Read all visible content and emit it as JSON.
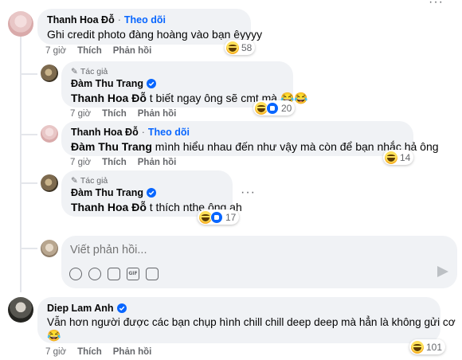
{
  "top_more": "···",
  "comment1": {
    "name": "Thanh Hoa Đỗ",
    "follow": "Theo dõi",
    "text": "Ghi credit photo đàng hoàng vào bạn êyyyy",
    "reactions": "58",
    "time": "7 giờ",
    "like": "Thích",
    "reply": "Phản hồi"
  },
  "reply1": {
    "badge": "Tác giả",
    "name": "Đàm Thu Trang",
    "tag": "Thanh Hoa Đỗ",
    "text": " t biết ngay ông sẽ cmt mà 😂😂",
    "reactions": "20",
    "time": "7 giờ",
    "like": "Thích",
    "reply": "Phản hồi"
  },
  "reply2": {
    "name": "Thanh Hoa Đỗ",
    "follow": "Theo dõi",
    "tag": "Đàm Thu Trang",
    "text": " mình hiểu nhau đến như vậy mà còn để bạn nhắc hả ông",
    "reactions": "14",
    "time": "7 giờ",
    "like": "Thích",
    "reply": "Phản hồi"
  },
  "reply3": {
    "badge": "Tác giả",
    "name": "Đàm Thu Trang",
    "tag": "Thanh Hoa Đỗ",
    "text": " t thích nthe ông ah",
    "reactions": "17",
    "more": "···"
  },
  "reply_box": {
    "placeholder": "Viết phản hồi..."
  },
  "comment2": {
    "name": "Diep Lam Anh",
    "text": "Vẫn hơn người được các bạn chụp hình chill chill deep deep mà hẳn là không gửi cơ",
    "emoji": "😂",
    "reactions": "101",
    "time": "7 giờ",
    "like": "Thích",
    "reply": "Phản hồi"
  },
  "colors": {
    "link": "#0866ff",
    "bubble": "#f0f2f5",
    "secondary_text": "#65676b"
  }
}
